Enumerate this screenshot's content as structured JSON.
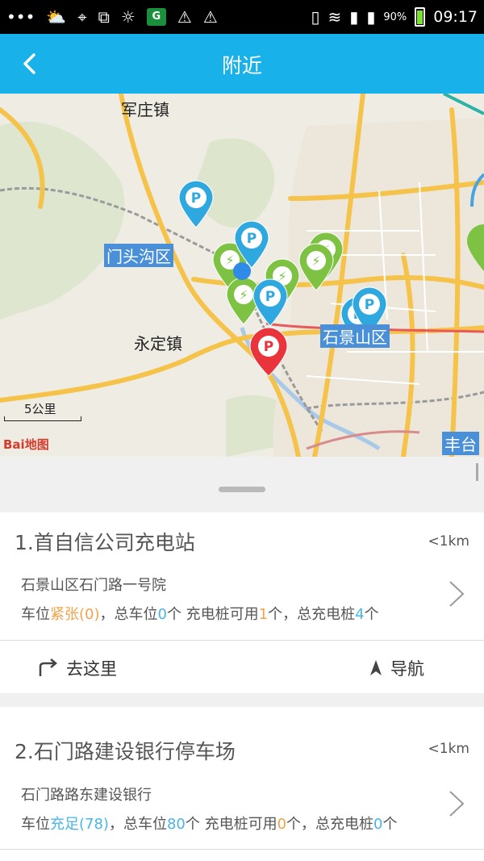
{
  "status_bar": {
    "icons": [
      "more-icon",
      "weather-cloud-sun-icon",
      "gps-icon",
      "screenshot-icon",
      "weather-sun-cloud-icon",
      "app-green-icon",
      "warning-icon",
      "warning-icon",
      "no-sim-icon",
      "wifi-icon",
      "sim1-icon",
      "sim2-icon",
      "battery-icon"
    ],
    "battery_pct": "90%",
    "time": "09:17"
  },
  "title_bar": {
    "title": "附近",
    "bg_color": "#19b1ea"
  },
  "map": {
    "labels": {
      "junzhuang": "军庄镇",
      "mentougou": "门头沟区",
      "yongding": "永定镇",
      "shijingshan": "石景山区",
      "fengtai": "丰台"
    },
    "scale": "5公里",
    "logo": "Bai地图",
    "marker_colors": {
      "parking": "#2fa8e0",
      "charging": "#7dc242",
      "selected": "#e8343a"
    }
  },
  "stations": [
    {
      "title": "1.首自信公司充电站",
      "distance": "<1km",
      "address": "石景山区石门路一号院",
      "info": {
        "p1": "车位",
        "status": "紧张(0)",
        "p2": "，总车位",
        "total": "0",
        "p3": "个 充电桩可用",
        "avail": "1",
        "p4": "个，总充电桩",
        "piles": "4",
        "p5": "个"
      },
      "go_label": "去这里",
      "nav_label": "导航"
    },
    {
      "title": "2.石门路建设银行停车场",
      "distance": "<1km",
      "address": "石门路路东建设银行",
      "info": {
        "p1": "车位",
        "status": "充足(78)",
        "p2": "，总车位",
        "total": "80",
        "p3": "个 充电桩可用",
        "avail": "0",
        "p4": "个，总充电桩",
        "piles": "0",
        "p5": "个"
      }
    }
  ]
}
